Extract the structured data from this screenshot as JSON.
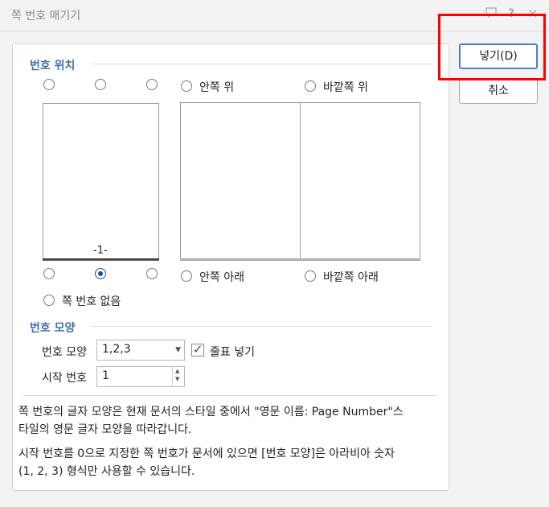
{
  "window": {
    "title": "쪽 번호 매기기",
    "icons": [
      "chat-icon",
      "help-icon",
      "close-icon"
    ],
    "help_glyph": "?",
    "close_glyph": "×"
  },
  "position_section": {
    "title": "번호 위치",
    "options": {
      "inner_top": "안쪽 위",
      "outer_top": "바깥쪽 위",
      "inner_bottom": "안쪽 아래",
      "outer_bottom": "바깥쪽 아래",
      "none": "쪽 번호 없음"
    },
    "selected": "bottom-center",
    "preview_number": "-1-"
  },
  "format_section": {
    "title": "번호 모양",
    "format_label": "번호 모양",
    "format_value": "1,2,3",
    "hyphen_label": "줄표 넣기",
    "hyphen_checked": true,
    "start_label": "시작 번호",
    "start_value": "1"
  },
  "description": {
    "line1": "쪽 번호의 글자 모양은 현재 문서의 스타일 중에서 \"영문 이름: Page Number\"스",
    "line2": "타일의 영문 글자 모양을 따라갑니다.",
    "line3": "시작 번호를 0으로 지정한 쪽 번호가 문서에 있으면 [번호 모양]은 아라비아 숫자",
    "line4": "(1, 2, 3) 형식만 사용할 수 있습니다."
  },
  "buttons": {
    "insert": "넣기(D)",
    "cancel": "취소"
  },
  "colors": {
    "accent": "#3e6fb0",
    "highlight": "#ff0000"
  }
}
